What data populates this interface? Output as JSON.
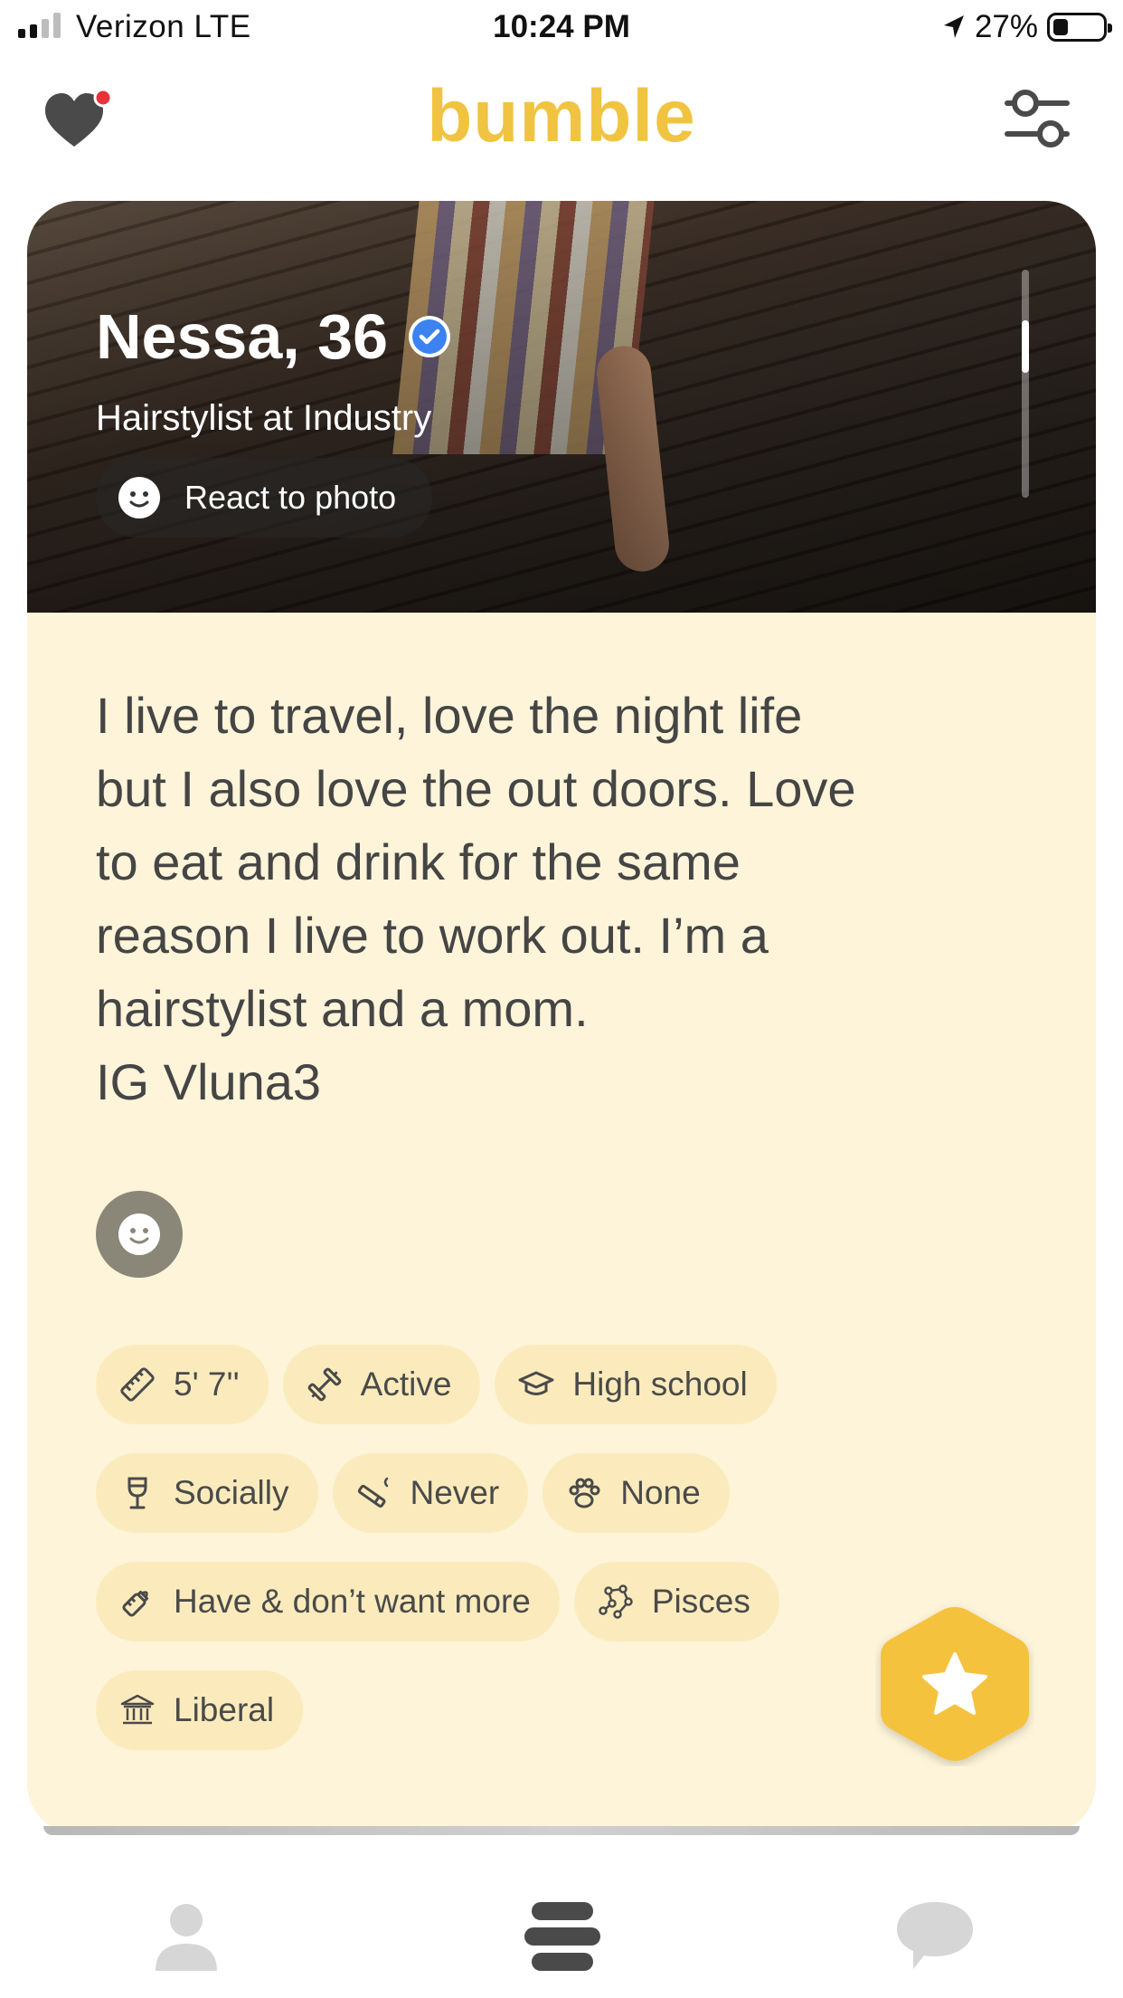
{
  "status_bar": {
    "carrier": "Verizon  LTE",
    "time": "10:24 PM",
    "battery_percent": "27%",
    "battery_level": 0.27,
    "signal_bars": 2
  },
  "header": {
    "brand": "bumble",
    "brand_color": "#f0c441",
    "notification_dot_color": "#e8333a"
  },
  "profile": {
    "name_age": "Nessa, 36",
    "job": "Hairstylist at Industry",
    "react_label": "React to photo",
    "bio": "I live to travel, love the night life\nbut I also love the out doors. Love\nto eat and drink for the same\nreason I live to work out. I’m a\nhairstylist and a mom.\nIG Vluna3",
    "verified_color": "#3c82f0",
    "card_color": "#fdf4d9",
    "badge_color": "#fbebbc",
    "badges": {
      "height": {
        "label": "5' 7''",
        "icon": "ruler-icon"
      },
      "exercise": {
        "label": "Active",
        "icon": "dumbbell-icon"
      },
      "education": {
        "label": "High school",
        "icon": "graduation-cap-icon"
      },
      "drinking": {
        "label": "Socially",
        "icon": "wine-glass-icon"
      },
      "smoking": {
        "label": "Never",
        "icon": "cigarette-icon"
      },
      "pets": {
        "label": "None",
        "icon": "paw-icon"
      },
      "kids": {
        "label": "Have & don’t want more",
        "icon": "baby-bottle-icon"
      },
      "zodiac": {
        "label": "Pisces",
        "icon": "constellation-icon"
      },
      "politics": {
        "label": "Liberal",
        "icon": "government-building-icon"
      }
    }
  },
  "nav": {
    "items": [
      "profile-icon",
      "swipe-stack-icon",
      "chat-icon"
    ]
  }
}
